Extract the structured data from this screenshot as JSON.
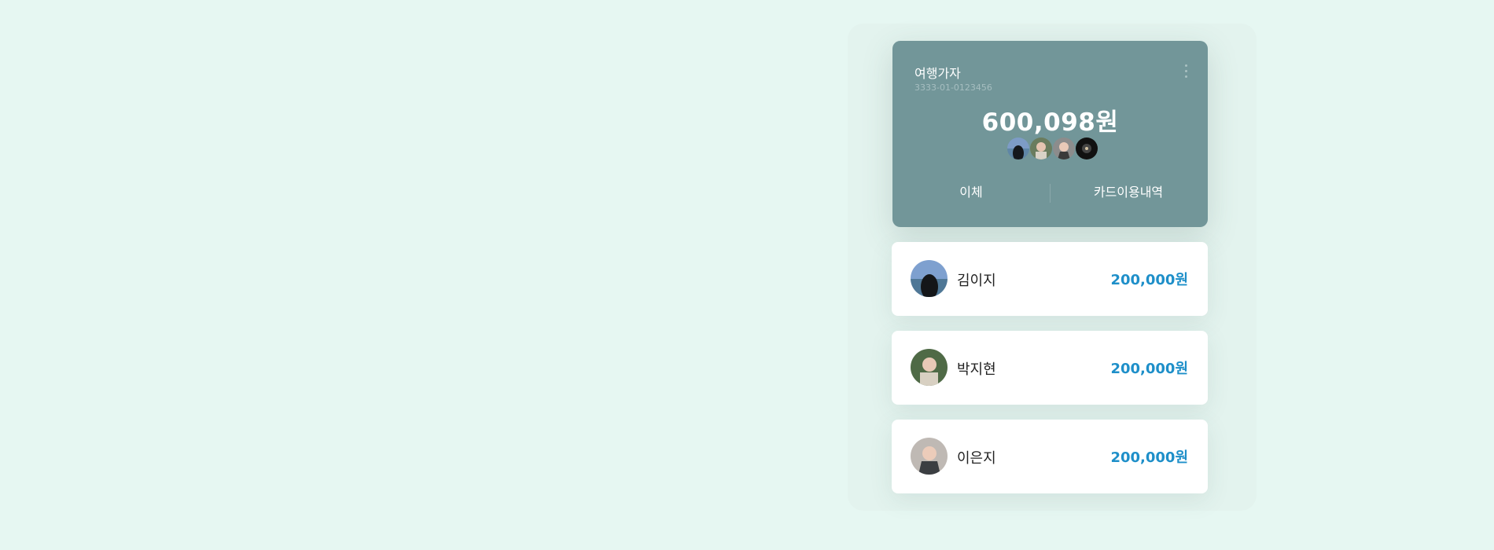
{
  "account": {
    "name": "여행가자",
    "number": "3333-01-0123456",
    "balance": "600,098원",
    "more_icon": "more-vertical-icon",
    "actions": {
      "transfer": "이체",
      "card_history": "카드이용내역"
    }
  },
  "members": [
    {
      "name": "김이지",
      "amount": "200,000원"
    },
    {
      "name": "박지현",
      "amount": "200,000원"
    },
    {
      "name": "이은지",
      "amount": "200,000원"
    }
  ],
  "colors": {
    "background": "#e6f7f2",
    "card": "#729699",
    "amount_accent": "#1e8fc9"
  }
}
